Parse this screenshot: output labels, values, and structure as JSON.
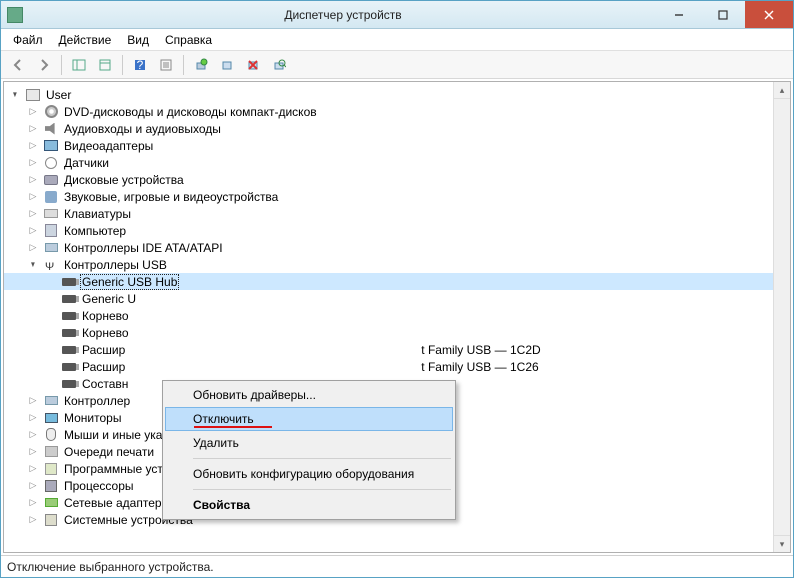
{
  "window": {
    "title": "Диспетчер устройств"
  },
  "menubar": [
    "Файл",
    "Действие",
    "Вид",
    "Справка"
  ],
  "tree": {
    "root": "User",
    "nodes": [
      {
        "label": "DVD-дисководы и дисководы компакт-дисков",
        "icon": "ic-cd",
        "exp": "closed"
      },
      {
        "label": "Аудиовходы и аудиовыходы",
        "icon": "ic-audio",
        "exp": "closed"
      },
      {
        "label": "Видеоадаптеры",
        "icon": "ic-display",
        "exp": "closed"
      },
      {
        "label": "Датчики",
        "icon": "ic-sensor",
        "exp": "closed"
      },
      {
        "label": "Дисковые устройства",
        "icon": "ic-disk",
        "exp": "closed"
      },
      {
        "label": "Звуковые, игровые и видеоустройства",
        "icon": "ic-sound",
        "exp": "closed"
      },
      {
        "label": "Клавиатуры",
        "icon": "ic-keyboard",
        "exp": "closed"
      },
      {
        "label": "Компьютер",
        "icon": "ic-pc",
        "exp": "closed"
      },
      {
        "label": "Контроллеры IDE ATA/ATAPI",
        "icon": "ic-ide",
        "exp": "closed"
      },
      {
        "label": "Контроллеры USB",
        "icon": "ic-usb",
        "exp": "open",
        "children": [
          {
            "label": "Generic USB Hub",
            "icon": "ic-usbplug",
            "selected": true
          },
          {
            "label": "Generic U",
            "icon": "ic-usbplug"
          },
          {
            "label": "Корнево",
            "icon": "ic-usbplug"
          },
          {
            "label": "Корнево",
            "icon": "ic-usbplug"
          },
          {
            "label": "Расшир",
            "icon": "ic-usbplug",
            "suffix": "t Family USB — 1C2D"
          },
          {
            "label": "Расшир",
            "icon": "ic-usbplug",
            "suffix": "t Family USB — 1C26"
          },
          {
            "label": "Составн",
            "icon": "ic-usbplug"
          }
        ]
      },
      {
        "label": "Контроллер",
        "icon": "ic-ide",
        "exp": "closed"
      },
      {
        "label": "Мониторы",
        "icon": "ic-monitor",
        "exp": "closed"
      },
      {
        "label": "Мыши и иные указывающие устройства",
        "icon": "ic-mouse",
        "exp": "closed"
      },
      {
        "label": "Очереди печати",
        "icon": "ic-printer",
        "exp": "closed"
      },
      {
        "label": "Программные устройства",
        "icon": "ic-soft",
        "exp": "closed"
      },
      {
        "label": "Процессоры",
        "icon": "ic-cpu",
        "exp": "closed"
      },
      {
        "label": "Сетевые адаптеры",
        "icon": "ic-net",
        "exp": "closed"
      },
      {
        "label": "Системные устройства",
        "icon": "ic-sys",
        "exp": "closed"
      }
    ]
  },
  "context_menu": {
    "items": [
      {
        "label": "Обновить драйверы..."
      },
      {
        "label": "Отключить",
        "hover": true,
        "underline": true
      },
      {
        "label": "Удалить"
      },
      {
        "sep": true
      },
      {
        "label": "Обновить конфигурацию оборудования"
      },
      {
        "sep": true
      },
      {
        "label": "Свойства",
        "bold": true
      }
    ]
  },
  "statusbar": "Отключение выбранного устройства."
}
